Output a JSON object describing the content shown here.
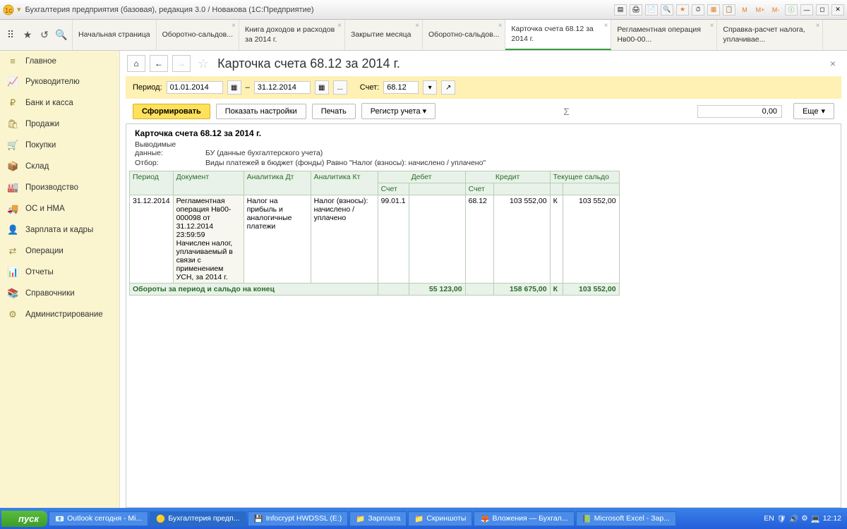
{
  "titlebar": {
    "title": "Бухгалтерия предприятия (базовая), редакция 3.0 / Новакова  (1С:Предприятие)",
    "btns": [
      "M",
      "M+",
      "M-"
    ]
  },
  "tabs": [
    {
      "label": "Начальная страница"
    },
    {
      "label": "Оборотно-сальдов..."
    },
    {
      "label": "Книга доходов и расходов за 2014 г."
    },
    {
      "label": "Закрытие месяца"
    },
    {
      "label": "Оборотно-сальдов..."
    },
    {
      "label": "Карточка счета 68.12 за 2014 г.",
      "active": true
    },
    {
      "label": "Регламентная операция Нв00-00..."
    },
    {
      "label": "Справка-расчет налога, уплачивае..."
    }
  ],
  "sidebar": [
    {
      "icon": "≡",
      "label": "Главное"
    },
    {
      "icon": "📈",
      "label": "Руководителю"
    },
    {
      "icon": "₽",
      "label": "Банк и касса"
    },
    {
      "icon": "🛍",
      "label": "Продажи"
    },
    {
      "icon": "🛒",
      "label": "Покупки"
    },
    {
      "icon": "📦",
      "label": "Склад"
    },
    {
      "icon": "🏭",
      "label": "Производство"
    },
    {
      "icon": "🚚",
      "label": "ОС и НМА"
    },
    {
      "icon": "👤",
      "label": "Зарплата и кадры"
    },
    {
      "icon": "⇄",
      "label": "Операции"
    },
    {
      "icon": "📊",
      "label": "Отчеты"
    },
    {
      "icon": "📚",
      "label": "Справочники"
    },
    {
      "icon": "⚙",
      "label": "Администрирование"
    }
  ],
  "page": {
    "title": "Карточка счета 68.12 за 2014 г."
  },
  "filter": {
    "period_label": "Период:",
    "date_from": "01.01.2014",
    "dash": "–",
    "date_to": "31.12.2014",
    "account_label": "Счет:",
    "account": "68.12"
  },
  "actions": {
    "generate": "Сформировать",
    "settings": "Показать настройки",
    "print": "Печать",
    "register": "Регистр учета",
    "sum_display": "0,00",
    "more": "Еще"
  },
  "report": {
    "title": "Карточка счета 68.12 за 2014 г.",
    "meta1_label": "Выводимые данные:",
    "meta1_value": "БУ (данные бухгалтерского учета)",
    "meta2_label": "Отбор:",
    "meta2_value": "Виды платежей в бюджет (фонды) Равно \"Налог (взносы): начислено / уплачено\"",
    "headers": {
      "period": "Период",
      "document": "Документ",
      "analytics_dt": "Аналитика Дт",
      "analytics_kt": "Аналитика Кт",
      "debit": "Дебет",
      "credit": "Кредит",
      "balance": "Текущее сальдо",
      "account": "Счет"
    },
    "row": {
      "period": "31.12.2014",
      "document": "Регламентная операция Нв00-000098 от 31.12.2014 23:59:59 Начислен налог, уплачиваемый в связи с применением УСН, за 2014 г.",
      "analytics_dt": "Налог на прибыль и аналогичные платежи",
      "analytics_kt": "Налог (взносы): начислено / уплачено",
      "debit_acc": "99.01.1",
      "debit_sum": "",
      "credit_acc": "68.12",
      "credit_sum": "103 552,00",
      "balance_type": "К",
      "balance_sum": "103 552,00"
    },
    "totals": {
      "label": "Обороты за период и сальдо на конец",
      "debit": "55 123,00",
      "credit": "158 675,00",
      "balance_type": "К",
      "balance_sum": "103 552,00"
    }
  },
  "taskbar": {
    "start": "пуск",
    "tasks": [
      "Outlook сегодня - Mi...",
      "Бухгалтерия предп...",
      "Infocrypt HWDSSL (E:)",
      "Зарплата",
      "Скриншоты",
      "Вложения — Бухгал...",
      "Microsoft Excel - Зар..."
    ],
    "tray_lang": "EN",
    "clock": "12:12"
  }
}
